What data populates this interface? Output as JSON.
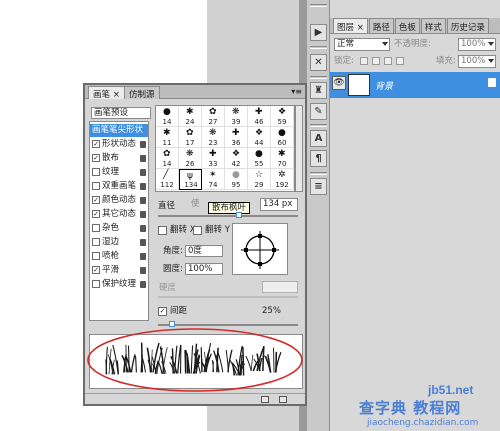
{
  "layers_panel": {
    "tabs": [
      "图层 ×",
      "路径",
      "色板",
      "样式",
      "历史记录"
    ],
    "blend_mode": "正常",
    "opacity_label": "不透明度:",
    "opacity_value": "100%",
    "lock_label": "锁定:",
    "fill_label": "填充:",
    "fill_value": "100%",
    "layer_name": "背景"
  },
  "brush_panel": {
    "tab_brush": "画笔 ×",
    "tab_clone": "仿制源",
    "presets_label": "画笔预设",
    "list": [
      {
        "label": "画笔笔尖形状",
        "checkbox": false,
        "checked": false,
        "lock": false,
        "selected": true
      },
      {
        "label": "形状动态",
        "checkbox": true,
        "checked": true,
        "lock": true,
        "selected": false
      },
      {
        "label": "散布",
        "checkbox": true,
        "checked": true,
        "lock": true,
        "selected": false
      },
      {
        "label": "纹理",
        "checkbox": true,
        "checked": false,
        "lock": true,
        "selected": false
      },
      {
        "label": "双重画笔",
        "checkbox": true,
        "checked": false,
        "lock": true,
        "selected": false
      },
      {
        "label": "颜色动态",
        "checkbox": true,
        "checked": true,
        "lock": true,
        "selected": false
      },
      {
        "label": "其它动态",
        "checkbox": true,
        "checked": true,
        "lock": true,
        "selected": false
      },
      {
        "label": "杂色",
        "checkbox": true,
        "checked": false,
        "lock": true,
        "selected": false
      },
      {
        "label": "湿边",
        "checkbox": true,
        "checked": false,
        "lock": true,
        "selected": false
      },
      {
        "label": "喷枪",
        "checkbox": true,
        "checked": false,
        "lock": true,
        "selected": false
      },
      {
        "label": "平滑",
        "checkbox": true,
        "checked": true,
        "lock": true,
        "selected": false
      },
      {
        "label": "保护纹理",
        "checkbox": true,
        "checked": false,
        "lock": true,
        "selected": false
      }
    ],
    "tips": [
      [
        "14",
        "24",
        "27",
        "39",
        "46",
        "59"
      ],
      [
        "11",
        "17",
        "23",
        "36",
        "44",
        "60"
      ],
      [
        "14",
        "26",
        "33",
        "42",
        "55",
        "70"
      ],
      [
        "112",
        "134",
        "74",
        "95",
        "29",
        "192"
      ]
    ],
    "selected_tip": "134",
    "diameter_label": "直径",
    "tooltip": "散布枫叶",
    "diameter_value": "134 px",
    "flip_x_label": "翻转 X",
    "flip_y_label": "翻转 Y",
    "angle_label": "角度:",
    "angle_value": "0度",
    "roundness_label": "圆度:",
    "roundness_value": "100%",
    "hardness_label": "硬度",
    "spacing_label": "间距",
    "spacing_checked": true,
    "spacing_value": "25%"
  },
  "watermark": {
    "site": "jb51.net",
    "cn_text": "查字典 教程网",
    "url": "jiaocheng.chazidian.com"
  },
  "colors": {
    "selection_blue": "#3f8fe1",
    "panel_gray": "#d6d6d6",
    "annotation_red": "#d32a2a",
    "watermark_blue": "#4a7fd6"
  }
}
